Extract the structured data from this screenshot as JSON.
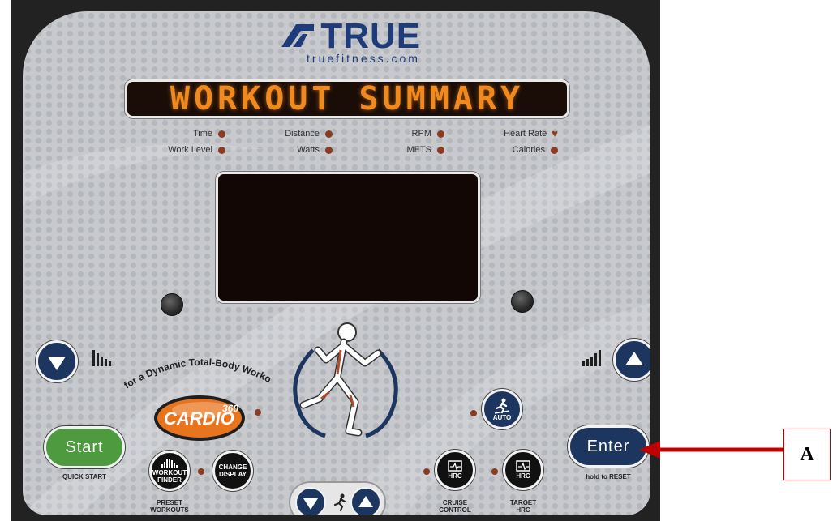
{
  "brand": {
    "name": "TRUE",
    "url": "truefitness.com"
  },
  "message_display": {
    "text": "WORKOUT SUMMARY",
    "color": "#f08a1e"
  },
  "indicators": [
    {
      "label": "Time",
      "marker": "dot"
    },
    {
      "label": "Work Level",
      "marker": "dot"
    },
    {
      "label": "Distance",
      "marker": "dot"
    },
    {
      "label": "Watts",
      "marker": "dot"
    },
    {
      "label": "RPM",
      "marker": "dot"
    },
    {
      "label": "METS",
      "marker": "dot"
    },
    {
      "label": "Heart Rate",
      "marker": "heart-icon"
    },
    {
      "label": "Calories",
      "marker": "dot"
    }
  ],
  "tagline": "for a Dynamic Total-Body Workout",
  "cardio_logo": {
    "text": "CARDIO",
    "superscript": "360"
  },
  "buttons": {
    "start": {
      "label": "Start",
      "caption": "QUICK START",
      "color": "#4e9a3e"
    },
    "enter": {
      "label": "Enter",
      "caption": "hold to RESET",
      "color": "#1d3660"
    },
    "workout_finder": {
      "line1": "WORKOUT",
      "line2": "FINDER",
      "caption_line1": "PRESET",
      "caption_line2": "WORKOUTS"
    },
    "change_display": {
      "line1": "CHANGE",
      "line2": "DISPLAY"
    },
    "auto": {
      "label": "AUTO"
    },
    "cruise_control": {
      "label": "HRC",
      "caption_line1": "CRUISE",
      "caption_line2": "CONTROL"
    },
    "target_hrc": {
      "label": "HRC",
      "caption_line1": "TARGET",
      "caption_line2": "HRC"
    }
  },
  "annotation": {
    "label": "A",
    "color": "#c00000"
  },
  "colors": {
    "panel": "#c7c9cd",
    "button_blue": "#1d3660",
    "indicator": "#8a3b22"
  }
}
